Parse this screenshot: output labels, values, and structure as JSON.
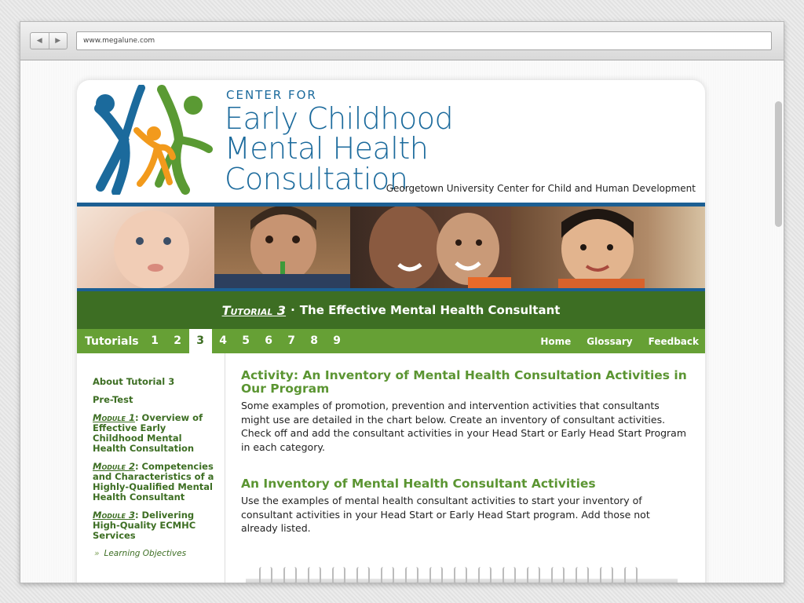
{
  "browser": {
    "url": "www.megalune.com",
    "back_glyph": "◀",
    "forward_glyph": "▶"
  },
  "header": {
    "center_for": "CENTER FOR",
    "title_line1": "Early Childhood",
    "title_line2": "Mental Health",
    "title_line3": "Consultation",
    "affiliation": "Georgetown University Center for Child and Human Development",
    "logo_colors": {
      "blue": "#1b6a9c",
      "green": "#5a9a33",
      "orange": "#f29a1c"
    }
  },
  "banner": {
    "tutorial_label": "Tutorial 3",
    "separator": "·",
    "title": "The Effective Mental Health Consultant"
  },
  "navbar": {
    "tutorials_label": "Tutorials",
    "numbers": [
      "1",
      "2",
      "3",
      "4",
      "5",
      "6",
      "7",
      "8",
      "9"
    ],
    "active_index": 2,
    "right_links": [
      "Home",
      "Glossary",
      "Feedback"
    ]
  },
  "sidebar": {
    "about": "About Tutorial 3",
    "pretest": "Pre-Test",
    "modules": [
      {
        "label": "Module 1",
        "text": ": Overview of Effective Early Childhood Mental Health Consultation"
      },
      {
        "label": "Module 2",
        "text": ": Competencies and Characteristics of a Highly-Qualified Mental Health Consultant"
      },
      {
        "label": "Module 3",
        "text": ": Delivering High-Quality ECMHC Services"
      }
    ],
    "sub_glyph": "»",
    "sub_item": "Learning Objectives"
  },
  "main": {
    "activity_title": "Activity: An Inventory of Mental Health Consultation Activities in Our Program",
    "activity_text": "Some examples of promotion, prevention and intervention activities that consultants might use are detailed in the chart below. Create an inventory of consultant activities. Check off and add the consultant activities in your Head Start or Early Head Start Program in each category.",
    "inventory_title": "An Inventory of Mental Health Consultant Activities",
    "inventory_text": "Use the examples of mental health consultant activities to start your inventory of consultant activities in your Head Start or Early Head Start program. Add those not already listed."
  },
  "colors": {
    "dark_green": "#3d6e23",
    "light_green": "#66a035",
    "blue": "#1c5f93"
  }
}
